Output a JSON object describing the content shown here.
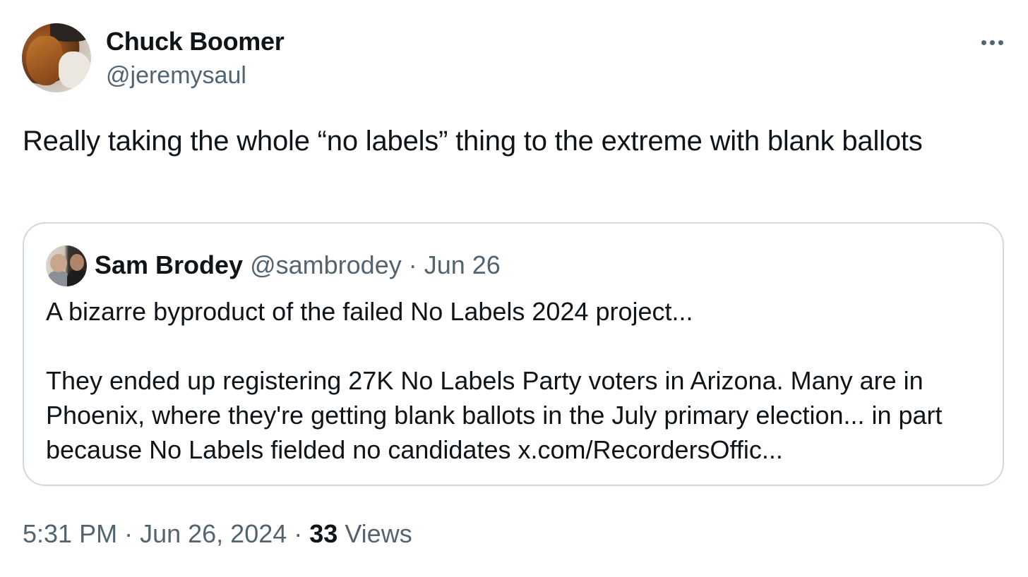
{
  "author": {
    "display_name": "Chuck Boomer",
    "handle": "@jeremysaul"
  },
  "icons": {
    "more": "more-options-icon",
    "avatar": "avatar"
  },
  "tweet": {
    "text": "Really taking the whole “no labels” thing to the extreme with blank ballots"
  },
  "quoted_tweet": {
    "display_name": "Sam Brodey",
    "handle": "@sambrodey",
    "separator": " · ",
    "date": "Jun 26",
    "text": "A bizarre byproduct of the failed No Labels 2024 project...\n\nThey ended up registering 27K No Labels Party voters in Arizona. Many are in Phoenix, where they're getting blank ballots in the July primary election... in part because No Labels fielded no candidates x.com/RecordersOffic..."
  },
  "meta": {
    "time": "5:31 PM",
    "separator1": " · ",
    "date": "Jun 26, 2024",
    "separator2": " · ",
    "views_count": "33",
    "views_label": " Views"
  },
  "colors": {
    "text_primary": "#0f1419",
    "text_secondary": "#536471",
    "border": "#cfd9de"
  }
}
